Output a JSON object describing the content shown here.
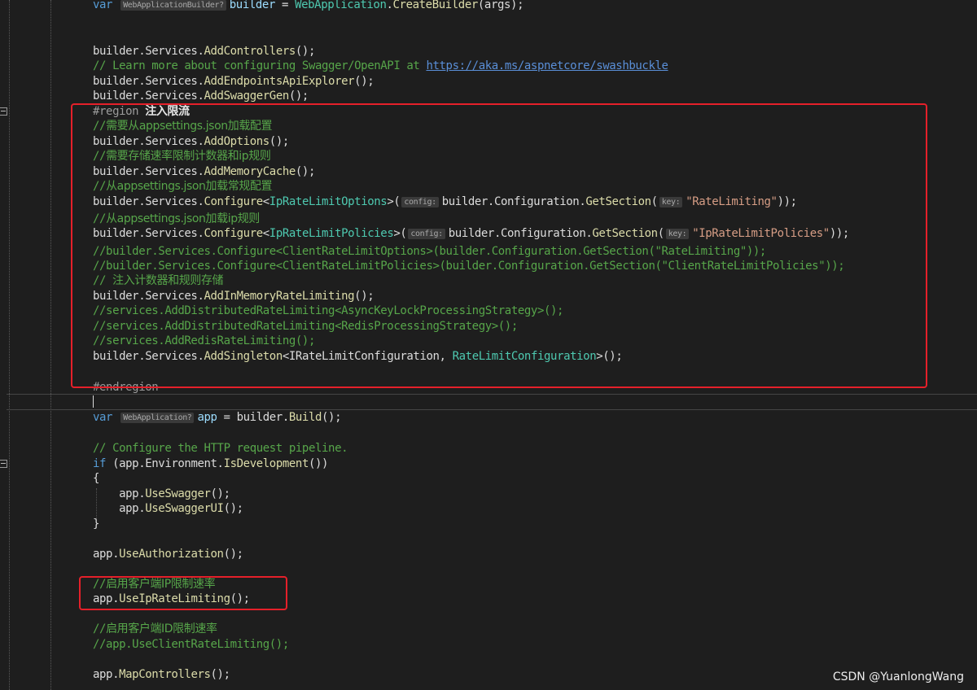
{
  "code_lines": [
    [
      [
        "kw",
        "var "
      ],
      [
        "hint",
        "WebApplicationBuilder?"
      ],
      [
        "id",
        "builder"
      ],
      [
        "pl",
        " = "
      ],
      [
        "ty",
        "WebApplication"
      ],
      [
        "pl",
        "."
      ],
      [
        "mt",
        "CreateBuilder"
      ],
      [
        "pl",
        "(args);"
      ]
    ],
    [],
    [
      [
        "pl",
        "builder.Services."
      ],
      [
        "mt",
        "AddControllers"
      ],
      [
        "pl",
        "();"
      ]
    ],
    [
      [
        "cm",
        "// Learn more about configuring Swagger/OpenAPI at "
      ],
      [
        "ln",
        "https://aka.ms/aspnetcore/swashbuckle"
      ]
    ],
    [
      [
        "pl",
        "builder.Services."
      ],
      [
        "mt",
        "AddEndpointsApiExplorer"
      ],
      [
        "pl",
        "();"
      ]
    ],
    [
      [
        "pl",
        "builder.Services."
      ],
      [
        "mt",
        "AddSwaggerGen"
      ],
      [
        "pl",
        "();"
      ]
    ],
    [],
    [
      [
        "rg",
        "#region "
      ],
      [
        "rgt",
        "注入限流"
      ]
    ],
    [
      [
        "cm",
        "//"
      ],
      [
        "cmc",
        "需要从appsettings.json加载配置"
      ]
    ],
    [
      [
        "pl",
        "builder.Services."
      ],
      [
        "mt",
        "AddOptions"
      ],
      [
        "pl",
        "();"
      ]
    ],
    [
      [
        "cm",
        "//"
      ],
      [
        "cmc",
        "需要存储速率限制计数器和ip规则"
      ]
    ],
    [
      [
        "pl",
        "builder.Services."
      ],
      [
        "mt",
        "AddMemoryCache"
      ],
      [
        "pl",
        "();"
      ]
    ],
    [
      [
        "cm",
        "//"
      ],
      [
        "cmc",
        "从appsettings.json加载常规配置"
      ]
    ],
    [
      [
        "pl",
        "builder.Services."
      ],
      [
        "mt",
        "Configure"
      ],
      [
        "pl",
        "<"
      ],
      [
        "ty",
        "IpRateLimitOptions"
      ],
      [
        "pl",
        ">("
      ],
      [
        "hint",
        "config:"
      ],
      [
        "pl",
        "builder.Configuration."
      ],
      [
        "mt",
        "GetSection"
      ],
      [
        "pl",
        "("
      ],
      [
        "hint",
        "key:"
      ],
      [
        "st",
        "\"RateLimiting\""
      ],
      [
        "pl",
        "));"
      ]
    ],
    [
      [
        "cm",
        "//"
      ],
      [
        "cmc",
        "从appsettings.json加载ip规则"
      ]
    ],
    [
      [
        "pl",
        "builder.Services."
      ],
      [
        "mt",
        "Configure"
      ],
      [
        "pl",
        "<"
      ],
      [
        "ty",
        "IpRateLimitPolicies"
      ],
      [
        "pl",
        ">("
      ],
      [
        "hint",
        "config:"
      ],
      [
        "pl",
        "builder.Configuration."
      ],
      [
        "mt",
        "GetSection"
      ],
      [
        "pl",
        "("
      ],
      [
        "hint",
        "key:"
      ],
      [
        "st",
        "\"IpRateLimitPolicies\""
      ],
      [
        "pl",
        "));"
      ]
    ],
    [
      [
        "cm",
        "//builder.Services.Configure<ClientRateLimitOptions>(builder.Configuration.GetSection(\"RateLimiting\"));"
      ]
    ],
    [
      [
        "cm",
        "//builder.Services.Configure<ClientRateLimitPolicies>(builder.Configuration.GetSection(\"ClientRateLimitPolicies\"));"
      ]
    ],
    [
      [
        "cm",
        "// "
      ],
      [
        "cmc",
        "注入计数器和规则存储"
      ]
    ],
    [
      [
        "pl",
        "builder.Services."
      ],
      [
        "mt",
        "AddInMemoryRateLimiting"
      ],
      [
        "pl",
        "();"
      ]
    ],
    [
      [
        "cm",
        "//services.AddDistributedRateLimiting<AsyncKeyLockProcessingStrategy>();"
      ]
    ],
    [
      [
        "cm",
        "//services.AddDistributedRateLimiting<RedisProcessingStrategy>();"
      ]
    ],
    [
      [
        "cm",
        "//services.AddRedisRateLimiting();"
      ]
    ],
    [
      [
        "pl",
        "builder.Services."
      ],
      [
        "mt",
        "AddSingleton"
      ],
      [
        "pl",
        "<IRateLimitConfiguration, "
      ],
      [
        "ty",
        "RateLimitConfiguration"
      ],
      [
        "pl",
        ">();"
      ]
    ],
    [],
    [
      [
        "rg",
        "#endregion"
      ]
    ],
    [],
    [
      [
        "kw",
        "var "
      ],
      [
        "hint",
        "WebApplication?"
      ],
      [
        "id",
        "app"
      ],
      [
        "pl",
        " = builder."
      ],
      [
        "mt",
        "Build"
      ],
      [
        "pl",
        "();"
      ]
    ],
    [],
    [
      [
        "cm",
        "// Configure the HTTP request pipeline."
      ]
    ],
    [
      [
        "kw",
        "if "
      ],
      [
        "pl",
        "(app.Environment."
      ],
      [
        "mt",
        "IsDevelopment"
      ],
      [
        "pl",
        "())"
      ]
    ],
    [
      [
        "pl",
        "{"
      ]
    ],
    [
      [
        "pl",
        "    app."
      ],
      [
        "mt",
        "UseSwagger"
      ],
      [
        "pl",
        "();"
      ]
    ],
    [
      [
        "pl",
        "    app."
      ],
      [
        "mt",
        "UseSwaggerUI"
      ],
      [
        "pl",
        "();"
      ]
    ],
    [
      [
        "pl",
        "}"
      ]
    ],
    [],
    [
      [
        "pl",
        "app."
      ],
      [
        "mt",
        "UseAuthorization"
      ],
      [
        "pl",
        "();"
      ]
    ],
    [],
    [
      [
        "cm",
        "//"
      ],
      [
        "cmc",
        "启用客户端IP限制速率"
      ]
    ],
    [
      [
        "pl",
        "app."
      ],
      [
        "mt",
        "UseIpRateLimiting"
      ],
      [
        "pl",
        "();"
      ]
    ],
    [],
    [
      [
        "cm",
        "//"
      ],
      [
        "cmc",
        "启用客户端ID限制速率"
      ]
    ],
    [
      [
        "cm",
        "//app.UseClientRateLimiting();"
      ]
    ],
    [],
    [
      [
        "pl",
        "app."
      ],
      [
        "mt",
        "MapControllers"
      ],
      [
        "pl",
        "();"
      ]
    ]
  ],
  "watermark": "CSDN @YuanlongWang",
  "colors": {
    "background": "#1e1e1e",
    "highlight_box": "#e5202a",
    "keyword": "#569cd6",
    "type": "#4ec9b0",
    "method": "#dcdcaa",
    "string": "#d69d85",
    "comment": "#57a64a"
  }
}
